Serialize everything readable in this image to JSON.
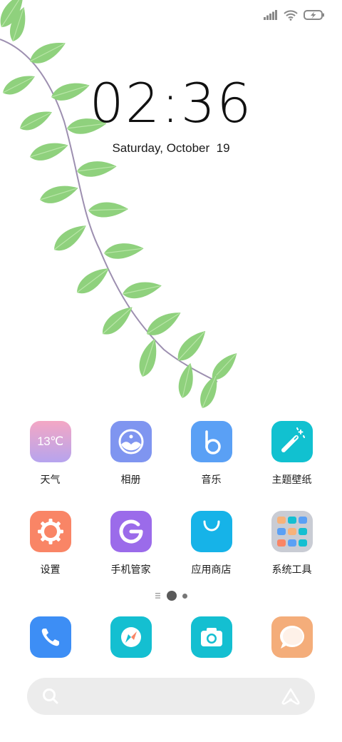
{
  "lock_clock": {
    "time": "02:36",
    "date": "Saturday, October  19"
  },
  "status_bar": {
    "icons": [
      "signal-icon",
      "wifi-icon",
      "battery-charging-icon"
    ]
  },
  "home_grid": {
    "row1": [
      {
        "label": "天气",
        "icon": "weather-icon",
        "temp": "13℃",
        "color_from": "#f4a7c4",
        "color_to": "#b6a4ee"
      },
      {
        "label": "相册",
        "icon": "gallery-icon",
        "color": "#7f95f0"
      },
      {
        "label": "音乐",
        "icon": "music-icon",
        "color": "#5aa0f5"
      },
      {
        "label": "主题壁纸",
        "icon": "themes-icon",
        "color": "#11c1d0"
      }
    ],
    "row2": [
      {
        "label": "设置",
        "icon": "settings-icon",
        "color": "#f98566"
      },
      {
        "label": "手机管家",
        "icon": "security-icon",
        "color": "#9b6bea"
      },
      {
        "label": "应用商店",
        "icon": "app-store-icon",
        "color": "#16b3e8"
      },
      {
        "label": "系统工具",
        "icon": "folder-icon",
        "color": "#c9ccd4"
      }
    ]
  },
  "page_indicator": {
    "pages": 2,
    "current": 1
  },
  "dock": [
    {
      "icon": "phone-icon",
      "color": "#3d8ef5"
    },
    {
      "icon": "browser-icon",
      "color": "#14bfd1"
    },
    {
      "icon": "camera-icon",
      "color": "#14bfd1"
    },
    {
      "icon": "messaging-icon",
      "color": "#f4ad7a"
    }
  ],
  "search_bar": {
    "search_icon": "search-icon",
    "assistant_icon": "assistant-icon"
  }
}
